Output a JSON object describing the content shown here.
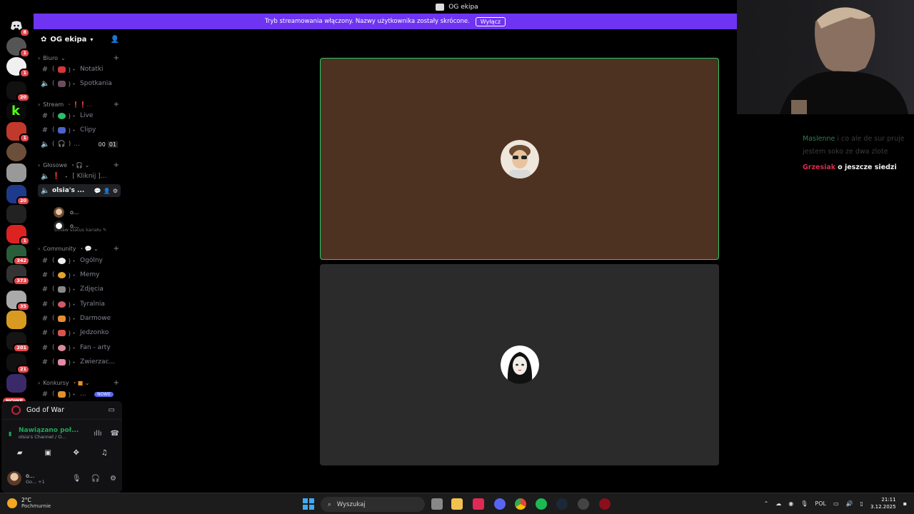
{
  "window": {
    "title": "OG ekipa"
  },
  "banner": {
    "text": "Tryb streamowania włączony. Nazwy użytkownika zostały skrócone.",
    "button": "Wyłącz"
  },
  "rail": {
    "badges": [
      "8",
      "1",
      "1",
      "20",
      "1",
      "20",
      "1",
      "201",
      "342",
      "373",
      "35",
      "201",
      "21"
    ],
    "nowe": "NOWE"
  },
  "server": {
    "name": "OG ekipa"
  },
  "sidebar": {
    "categories": {
      "biuro": "Biuro",
      "stream": "Stream",
      "glosowe": "Głosowe",
      "community": "Community",
      "konkursy": "Konkursy"
    },
    "channels": {
      "notatki": "Notatki",
      "spotkania": "Spotkania",
      "live": "Live",
      "clipy": "Clipy",
      "stream_voice": "...",
      "stream_voice_count": "00",
      "stream_voice_limit": "01",
      "kliknij": "[ Kliknij ]...",
      "olsia": "olsia's ...",
      "olsia_status": "Ustaw status kanału",
      "ogolny": "Ogólny",
      "memy": "Memy",
      "zdjecia": "Zdjęcia",
      "tyralnia": "Tyralnia",
      "darmowe": "Darmowe",
      "jedzonko": "Jedzonko",
      "fanarty": "Fan - arty",
      "zwierzaczki": "Zwierzac...",
      "konkurs_ch": "...",
      "konkurs_tag": "NOWE"
    },
    "voice_users": [
      "o...",
      "o..."
    ]
  },
  "activity": {
    "game": "God of War"
  },
  "connection": {
    "status": "Nawiązano poł...",
    "channel": "olsia's Channel / O..."
  },
  "user": {
    "name": "o...",
    "status": "Go...",
    "extra": "+1"
  },
  "chat": [
    {
      "user": "Maslenne",
      "message": "i co ale de sur pruje jestem soko ze dwa zlote"
    },
    {
      "user": "Grzesiak",
      "message": "o jeszcze siedzi"
    }
  ],
  "taskbar": {
    "weather_temp": "2°C",
    "weather_desc": "Pochmurnie",
    "search_placeholder": "Wyszukaj",
    "language": "POL",
    "time": "21:11",
    "date": "3.12.2025"
  },
  "colors": {
    "banner": "#6e34f2",
    "tile_active": "#4e3221",
    "tile_idle": "#2b2b2c",
    "speaking_ring": "#2dc770",
    "connected": "#23a55a"
  }
}
